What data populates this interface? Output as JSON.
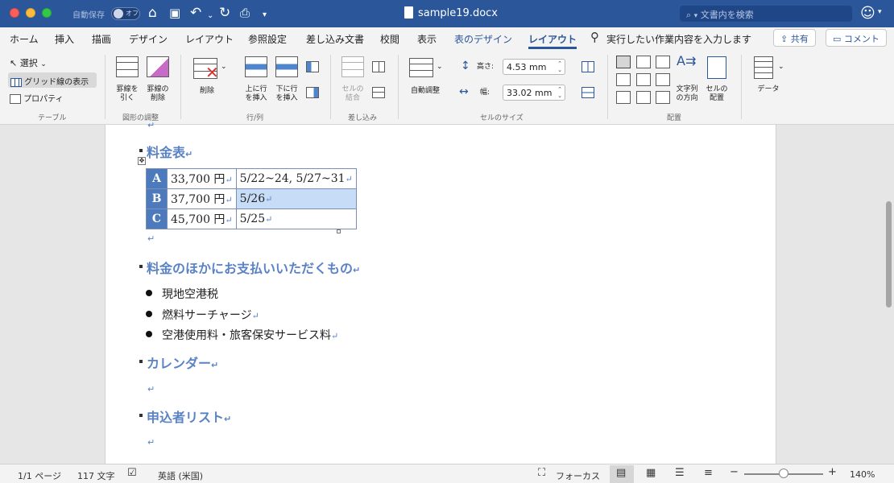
{
  "titlebar": {
    "autosave_label": "自動保存",
    "autosave_state": "オフ",
    "document_title": "sample19.docx",
    "search_placeholder": "文書内を検索"
  },
  "tabs": [
    "ホーム",
    "挿入",
    "描画",
    "デザイン",
    "レイアウト",
    "参照設定",
    "差し込み文書",
    "校閲",
    "表示",
    "表のデザイン",
    "レイアウト"
  ],
  "tell_me": "実行したい作業内容を入力します",
  "share_label": "共有",
  "comment_label": "コメント",
  "ribbon": {
    "table_group": {
      "select": "選択",
      "gridlines": "グリッド線の表示",
      "properties": "プロパティ",
      "label": "テーブル"
    },
    "draw_group": {
      "draw_line1": "罫線を",
      "draw_line2": "引く",
      "erase_line1": "罫線の",
      "erase_line2": "削除",
      "label": "図形の調整"
    },
    "rows_group": {
      "delete": "削除",
      "insert_above_1": "上に行",
      "insert_above_2": "を挿入",
      "insert_below_1": "下に行",
      "insert_below_2": "を挿入",
      "label": "行/列"
    },
    "merge_group": {
      "merge_1": "セルの",
      "merge_2": "結合",
      "label": "差し込み"
    },
    "size_group": {
      "autofit": "自動調整",
      "height_label": "高さ:",
      "height_value": "4.53 mm",
      "width_label": "幅:",
      "width_value": "33.02 mm",
      "label": "セルのサイズ"
    },
    "align_group": {
      "direction_1": "文字列",
      "direction_2": "の方向",
      "margins_1": "セルの",
      "margins_2": "配置",
      "label": "配置"
    },
    "data_group": {
      "data": "データ"
    }
  },
  "document": {
    "heading1": "料金表",
    "price_table": [
      {
        "label": "A",
        "price": "33,700 円",
        "dates": "5/22~24, 5/27~31"
      },
      {
        "label": "B",
        "price": "37,700 円",
        "dates": "5/26"
      },
      {
        "label": "C",
        "price": "45,700 円",
        "dates": "5/25"
      }
    ],
    "heading2": "料金のほかにお支払いいただくもの",
    "bullets": [
      "現地空港税",
      "燃料サーチャージ",
      "空港使用料・旅客保安サービス料"
    ],
    "heading3": "カレンダー",
    "heading4": "申込者リスト",
    "para_mark": "↵"
  },
  "statusbar": {
    "page": "1/1 ページ",
    "words": "117 文字",
    "language": "英語 (米国)",
    "focus": "フォーカス",
    "zoom_level": "140%",
    "zoom_fraction": 0.5
  },
  "colors": {
    "brand": "#2b579a",
    "heading": "#5a83c5",
    "row_label": "#4d79bd",
    "selection": "#c7dcf7"
  }
}
